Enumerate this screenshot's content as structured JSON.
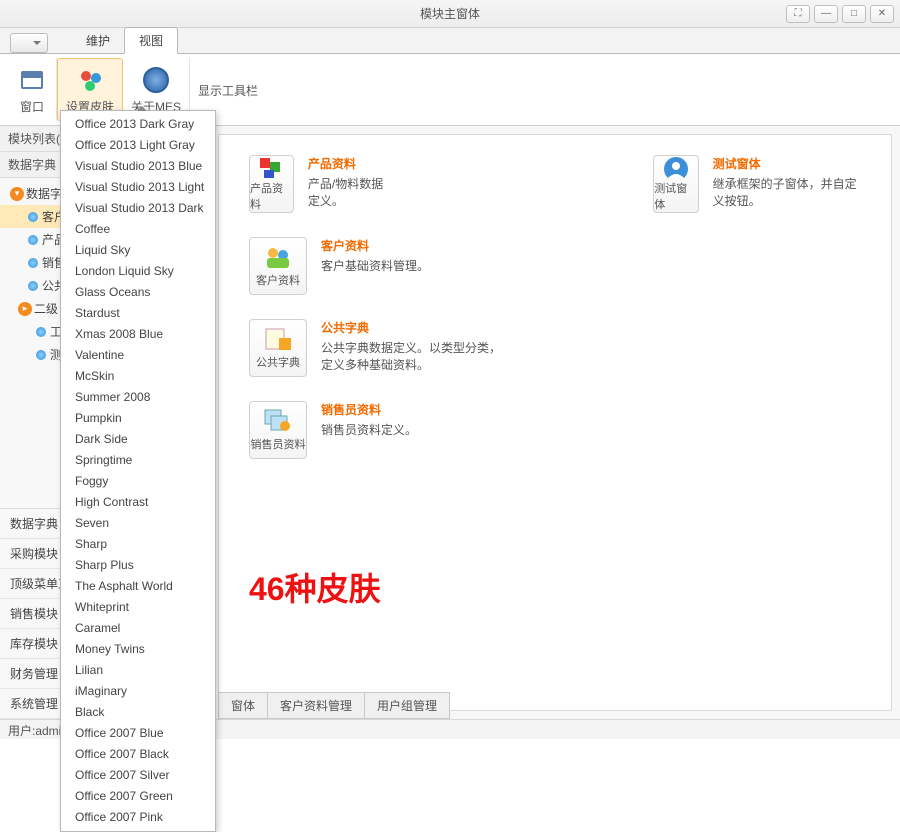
{
  "title": "模块主窗体",
  "ribbon": {
    "tabs": [
      "维护",
      "视图"
    ],
    "groups": {
      "window": "窗口",
      "skin": "设置皮肤",
      "about": "关于MES",
      "toolbar": "显示工具栏"
    }
  },
  "sidebar": {
    "title": "模块列表(",
    "tree": {
      "root": "数据字典",
      "group": "数据字典",
      "children": [
        "客户",
        "产品",
        "销售",
        "公共"
      ],
      "sub": "二级",
      "subchildren": [
        "工",
        "测试"
      ]
    },
    "groups": [
      "数据字典",
      "采购模块",
      "顶级菜单工",
      "销售模块",
      "库存模块",
      "财务管理",
      "系统管理"
    ]
  },
  "cards": {
    "product": {
      "title": "产品资料",
      "desc": "产品/物料数据定义。",
      "btn": "产品资料"
    },
    "test": {
      "title": "测试窗体",
      "desc": "继承框架的子窗体，并自定义按钮。",
      "btn": "测试窗体"
    },
    "customer": {
      "title": "客户资料",
      "desc": "客户基础资料管理。",
      "btn": "客户资料"
    },
    "dict": {
      "title": "公共字典",
      "desc": "公共字典数据定义。以类型分类，定义多种基础资料。",
      "btn": "公共字典"
    },
    "sales": {
      "title": "销售员资料",
      "desc": "销售员资料定义。",
      "btn": "销售员资料"
    }
  },
  "annotation": "46种皮肤",
  "bottom_tabs": [
    "窗体",
    "客户资料管理",
    "用户组管理"
  ],
  "status": "用户:admin",
  "skins": [
    "Office 2013 Dark Gray",
    "Office 2013 Light Gray",
    "Visual Studio 2013 Blue",
    "Visual Studio 2013 Light",
    "Visual Studio 2013 Dark",
    "Coffee",
    "Liquid Sky",
    "London Liquid Sky",
    "Glass Oceans",
    "Stardust",
    "Xmas 2008 Blue",
    "Valentine",
    "McSkin",
    "Summer 2008",
    "Pumpkin",
    "Dark Side",
    "Springtime",
    "Foggy",
    "High Contrast",
    "Seven",
    "Sharp",
    "Sharp Plus",
    "The Asphalt World",
    "Whiteprint",
    "Caramel",
    "Money Twins",
    "Lilian",
    "iMaginary",
    "Black",
    "Office 2007 Blue",
    "Office 2007 Black",
    "Office 2007 Silver",
    "Office 2007 Green",
    "Office 2007 Pink"
  ]
}
